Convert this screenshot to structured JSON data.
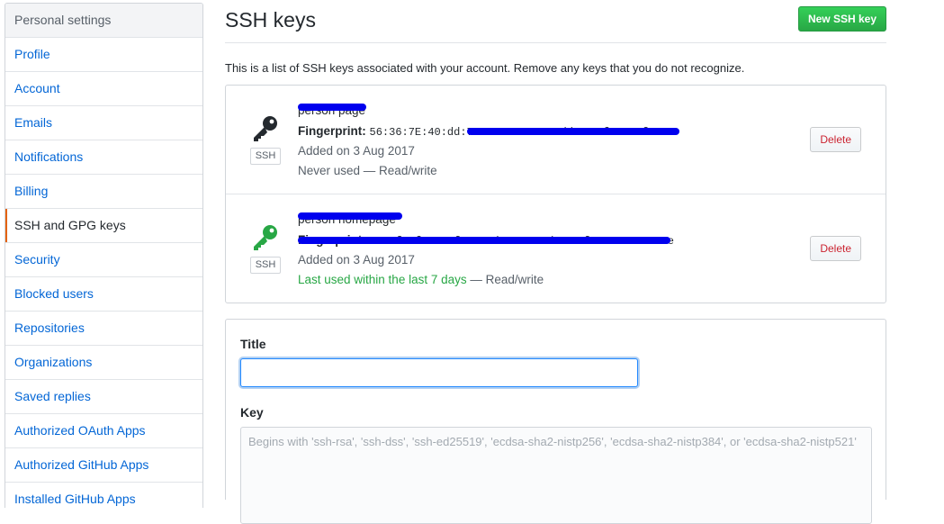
{
  "sidebar": {
    "header": "Personal settings",
    "items": [
      {
        "label": "Profile"
      },
      {
        "label": "Account"
      },
      {
        "label": "Emails"
      },
      {
        "label": "Notifications"
      },
      {
        "label": "Billing"
      },
      {
        "label": "SSH and GPG keys",
        "selected": true
      },
      {
        "label": "Security"
      },
      {
        "label": "Blocked users"
      },
      {
        "label": "Repositories"
      },
      {
        "label": "Organizations"
      },
      {
        "label": "Saved replies"
      },
      {
        "label": "Authorized OAuth Apps"
      },
      {
        "label": "Authorized GitHub Apps"
      },
      {
        "label": "Installed GitHub Apps"
      }
    ]
  },
  "main": {
    "title": "SSH keys",
    "new_button": "New SSH key",
    "intro": "This is a list of SSH keys associated with your account. Remove any keys that you do not recognize.",
    "keys": [
      {
        "name": "person page",
        "fingerprint_label": "Fingerprint:",
        "fingerprint": "56:36:7E:40:dd:70:95:42:75:aa:bb:4c:fe:28:f7:52",
        "badge": "SSH",
        "added": "Added on 3 Aug 2017",
        "usage": "Never used",
        "access": " — Read/write",
        "icon_color": "#24292e",
        "delete_label": "Delete"
      },
      {
        "name": "person homepage",
        "fingerprint_label": "Fingerprint:",
        "fingerprint": "5c:8f:6f:04:8f:32:0d:ce:53:5b:07:f3:9e:c5:7e:0e",
        "badge": "SSH",
        "added": "Added on 3 Aug 2017",
        "usage": "Last used within the last 7 days",
        "access": " — Read/write",
        "icon_color": "#28a745",
        "delete_label": "Delete"
      }
    ],
    "form": {
      "title_label": "Title",
      "title_value": "",
      "key_label": "Key",
      "key_placeholder": "Begins with 'ssh-rsa', 'ssh-dss', 'ssh-ed25519', 'ecdsa-sha2-nistp256', 'ecdsa-sha2-nistp384', or 'ecdsa-sha2-nistp521'"
    }
  },
  "colors": {
    "link": "#0366d6",
    "selected_marker": "#e36209",
    "primary_button": "#28a745",
    "danger_text": "#cb2431",
    "redaction": "#0000ee"
  }
}
